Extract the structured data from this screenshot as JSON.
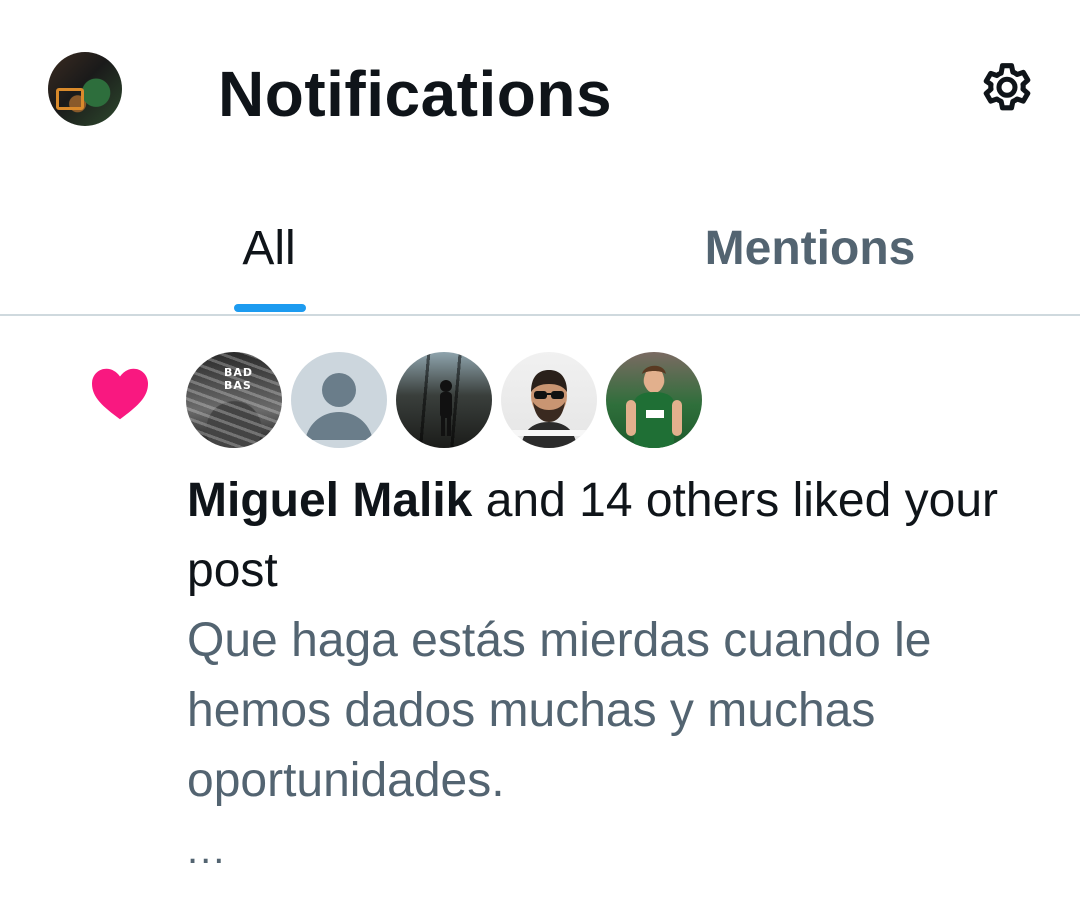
{
  "header": {
    "title": "Notifications",
    "account_avatar_icon": "profile-avatar",
    "settings_icon": "gear-icon"
  },
  "tabs": [
    {
      "label": "All",
      "selected": true
    },
    {
      "label": "Mentions",
      "selected": false
    }
  ],
  "colors": {
    "accent": "#1d9bf0",
    "like": "#f91880",
    "text_primary": "#0f1419",
    "text_secondary": "#536471",
    "divider": "#cfd9de"
  },
  "notification": {
    "type_icon": "heart-icon",
    "actor": "Miguel Malik",
    "summary_rest": " and 14 others liked your post",
    "post_text": "Que haga estás mierdas cuando le hemos dados muchas y muchas oportunidades.",
    "ellipsis": "...",
    "avatars": [
      {
        "name": "avatar-1",
        "sign_text": "BAD BAS"
      },
      {
        "name": "default-avatar"
      },
      {
        "name": "avatar-3"
      },
      {
        "name": "avatar-4"
      },
      {
        "name": "avatar-5"
      }
    ]
  }
}
